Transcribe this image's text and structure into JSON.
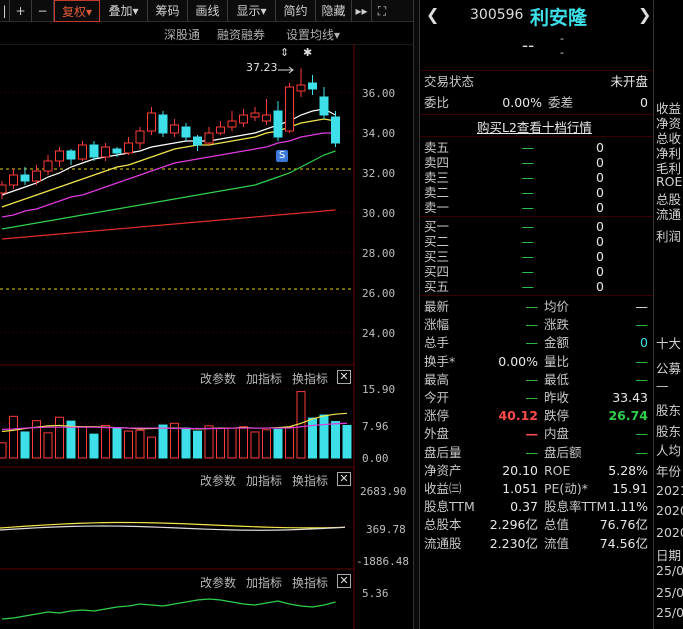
{
  "toolbar": {
    "items": [
      "|",
      "+",
      "−",
      "复权▾",
      "叠加▾",
      "筹码",
      "画线",
      "显示▾",
      "简约",
      "隐藏",
      "▸▸",
      "⛶"
    ],
    "selected": "复权▾"
  },
  "subbar": {
    "items": [
      "深股通",
      "融资融券",
      "设置均线▾"
    ]
  },
  "kline": {
    "peak_label": "37.23",
    "markers": [
      "⇕",
      "✱"
    ],
    "s_badge": "S",
    "y_ticks": [
      "36.00",
      "34.00",
      "32.00",
      "30.00",
      "28.00",
      "26.00",
      "24.00"
    ],
    "dash_levels": [
      32.2,
      26.2
    ],
    "candles": [
      {
        "o": 31.0,
        "c": 31.4,
        "h": 31.6,
        "l": 30.7,
        "up": true
      },
      {
        "o": 31.4,
        "c": 31.9,
        "h": 32.2,
        "l": 31.2,
        "up": true
      },
      {
        "o": 31.9,
        "c": 31.6,
        "h": 32.3,
        "l": 31.4,
        "up": false
      },
      {
        "o": 31.6,
        "c": 32.1,
        "h": 32.4,
        "l": 31.4,
        "up": true
      },
      {
        "o": 32.1,
        "c": 32.6,
        "h": 32.9,
        "l": 31.9,
        "up": true
      },
      {
        "o": 32.6,
        "c": 33.1,
        "h": 33.3,
        "l": 32.3,
        "up": true
      },
      {
        "o": 33.1,
        "c": 32.7,
        "h": 33.2,
        "l": 32.4,
        "up": false
      },
      {
        "o": 32.7,
        "c": 33.4,
        "h": 33.6,
        "l": 32.6,
        "up": true
      },
      {
        "o": 33.4,
        "c": 32.8,
        "h": 33.6,
        "l": 32.6,
        "up": false
      },
      {
        "o": 32.8,
        "c": 33.3,
        "h": 33.5,
        "l": 32.6,
        "up": true
      },
      {
        "o": 33.2,
        "c": 33.0,
        "h": 33.3,
        "l": 32.8,
        "up": false
      },
      {
        "o": 33.0,
        "c": 33.5,
        "h": 33.8,
        "l": 32.9,
        "up": true
      },
      {
        "o": 33.5,
        "c": 34.1,
        "h": 34.3,
        "l": 33.2,
        "up": true
      },
      {
        "o": 34.1,
        "c": 35.0,
        "h": 35.3,
        "l": 33.9,
        "up": true
      },
      {
        "o": 34.9,
        "c": 34.0,
        "h": 35.1,
        "l": 33.8,
        "up": false
      },
      {
        "o": 34.0,
        "c": 34.4,
        "h": 34.7,
        "l": 33.8,
        "up": true
      },
      {
        "o": 34.3,
        "c": 33.8,
        "h": 34.5,
        "l": 33.6,
        "up": false
      },
      {
        "o": 33.8,
        "c": 33.4,
        "h": 33.9,
        "l": 33.1,
        "up": false
      },
      {
        "o": 33.5,
        "c": 34.0,
        "h": 34.3,
        "l": 33.4,
        "up": true
      },
      {
        "o": 34.0,
        "c": 34.3,
        "h": 34.6,
        "l": 33.9,
        "up": true
      },
      {
        "o": 34.3,
        "c": 34.6,
        "h": 35.1,
        "l": 34.1,
        "up": true
      },
      {
        "o": 34.5,
        "c": 34.9,
        "h": 35.2,
        "l": 34.3,
        "up": true
      },
      {
        "o": 34.8,
        "c": 35.0,
        "h": 35.3,
        "l": 34.6,
        "up": true
      },
      {
        "o": 34.6,
        "c": 34.9,
        "h": 35.7,
        "l": 34.4,
        "up": true
      },
      {
        "o": 35.1,
        "c": 33.8,
        "h": 35.6,
        "l": 33.6,
        "up": false
      },
      {
        "o": 34.1,
        "c": 36.3,
        "h": 36.5,
        "l": 34.0,
        "up": true
      },
      {
        "o": 36.1,
        "c": 36.4,
        "h": 37.23,
        "l": 35.8,
        "up": true
      },
      {
        "o": 36.5,
        "c": 36.2,
        "h": 36.9,
        "l": 35.9,
        "up": false
      },
      {
        "o": 35.8,
        "c": 34.9,
        "h": 36.3,
        "l": 34.7,
        "up": false
      },
      {
        "o": 34.8,
        "c": 33.5,
        "h": 35.1,
        "l": 33.3,
        "up": false
      }
    ],
    "ma": {
      "white": [
        30.9,
        31.1,
        31.3,
        31.5,
        31.8,
        32.0,
        32.3,
        32.5,
        32.7,
        32.8,
        32.9,
        33.0,
        33.1,
        33.3,
        33.4,
        33.5,
        33.6,
        33.6,
        33.6,
        33.7,
        33.8,
        33.9,
        34.0,
        34.2,
        34.4,
        34.6,
        34.9,
        35.1,
        35.2,
        34.9
      ],
      "yellow": [
        30.3,
        30.5,
        30.7,
        30.9,
        31.1,
        31.3,
        31.5,
        31.7,
        31.9,
        32.1,
        32.3,
        32.4,
        32.6,
        32.8,
        33.0,
        33.2,
        33.3,
        33.4,
        33.4,
        33.5,
        33.6,
        33.7,
        33.8,
        34.0,
        34.1,
        34.3,
        34.5,
        34.6,
        34.7,
        34.6
      ],
      "magenta": [
        29.8,
        29.9,
        30.1,
        30.2,
        30.4,
        30.6,
        30.8,
        30.9,
        31.1,
        31.3,
        31.5,
        31.7,
        31.9,
        32.1,
        32.3,
        32.5,
        32.6,
        32.7,
        32.8,
        32.9,
        33.0,
        33.1,
        33.2,
        33.3,
        33.5,
        33.6,
        33.8,
        33.9,
        34.0,
        34.0
      ],
      "green": [
        29.2,
        29.3,
        29.4,
        29.5,
        29.6,
        29.7,
        29.8,
        29.9,
        30.0,
        30.1,
        30.2,
        30.3,
        30.4,
        30.5,
        30.6,
        30.7,
        30.8,
        30.9,
        31.0,
        31.1,
        31.2,
        31.3,
        31.4,
        31.6,
        31.8,
        32.0,
        32.3,
        32.6,
        32.9,
        33.1
      ],
      "red": [
        28.7,
        28.75,
        28.8,
        28.85,
        28.9,
        28.95,
        29.0,
        29.05,
        29.1,
        29.15,
        29.2,
        29.25,
        29.3,
        29.35,
        29.4,
        29.45,
        29.5,
        29.55,
        29.6,
        29.65,
        29.7,
        29.75,
        29.8,
        29.85,
        29.9,
        29.95,
        30.0,
        30.05,
        30.1,
        30.15
      ]
    }
  },
  "volume_panel": {
    "tabs": [
      "改参数",
      "加指标",
      "换指标"
    ],
    "y_ticks": [
      "15.90",
      "7.96",
      "0.00"
    ],
    "bars": [
      3.5,
      9.6,
      6.0,
      8.6,
      5.8,
      9.4,
      8.5,
      7.2,
      5.5,
      7.5,
      6.8,
      6.2,
      6.4,
      4.8,
      7.6,
      8.0,
      6.9,
      6.2,
      7.4,
      6.9,
      6.9,
      7.2,
      6.0,
      6.5,
      6.6,
      7.1,
      15.3,
      9.2,
      9.9,
      8.4,
      7.5
    ],
    "bar_up": [
      true,
      true,
      false,
      true,
      true,
      true,
      false,
      true,
      false,
      true,
      false,
      true,
      true,
      true,
      false,
      true,
      false,
      false,
      true,
      true,
      true,
      true,
      true,
      true,
      false,
      true,
      true,
      false,
      false,
      false,
      false
    ],
    "ma_yellow": [
      6.1,
      6.4,
      6.8,
      7.1,
      7.4,
      7.5,
      7.3,
      7.2,
      7.2,
      7.1,
      7.0,
      6.9,
      6.7,
      6.8,
      6.9,
      6.9,
      6.8,
      6.7,
      6.8,
      6.9,
      6.9,
      7.0,
      6.9,
      6.9,
      7.0,
      7.2,
      8.0,
      9.0,
      9.7,
      10.1,
      10.3
    ],
    "ma_magenta": [
      6.6,
      6.7,
      6.9,
      7.0,
      7.1,
      7.1,
      7.1,
      7.1,
      7.1,
      7.0,
      7.0,
      6.9,
      6.9,
      6.9,
      6.9,
      6.8,
      6.8,
      6.8,
      6.8,
      6.8,
      6.9,
      6.9,
      6.9,
      6.9,
      6.9,
      6.9,
      7.2,
      7.5,
      7.7,
      7.9,
      8.0
    ]
  },
  "macd_panel": {
    "tabs": [
      "改参数",
      "加指标",
      "换指标"
    ],
    "y_ticks": [
      "2683.90",
      "369.78",
      "-1886.48"
    ]
  },
  "bottom_panel": {
    "tabs": [
      "改参数",
      "加指标",
      "换指标"
    ],
    "y_ticks": [
      "5.36"
    ]
  },
  "quote": {
    "code": "300596",
    "name": "利安隆",
    "price": "--",
    "change": "-",
    "change_pct": "-",
    "status_label": "交易状态",
    "status": "未开盘",
    "weibi_label": "委比",
    "weibi": "0.00%",
    "weicha_label": "委差",
    "weicha": "0",
    "l2_link": "购买L2查看十档行情",
    "asks": [
      {
        "label": "卖五",
        "price": "—",
        "vol": "0"
      },
      {
        "label": "卖四",
        "price": "—",
        "vol": "0"
      },
      {
        "label": "卖三",
        "price": "—",
        "vol": "0"
      },
      {
        "label": "卖二",
        "price": "—",
        "vol": "0"
      },
      {
        "label": "卖一",
        "price": "—",
        "vol": "0"
      }
    ],
    "bids": [
      {
        "label": "买一",
        "price": "—",
        "vol": "0"
      },
      {
        "label": "买二",
        "price": "—",
        "vol": "0"
      },
      {
        "label": "买三",
        "price": "—",
        "vol": "0"
      },
      {
        "label": "买四",
        "price": "—",
        "vol": "0"
      },
      {
        "label": "买五",
        "price": "—",
        "vol": "0"
      }
    ],
    "stats": [
      {
        "l1": "最新",
        "v1": "—",
        "c1": "g",
        "l2": "均价",
        "v2": "—",
        "c2": "w"
      },
      {
        "l1": "涨幅",
        "v1": "—",
        "c1": "g",
        "l2": "涨跌",
        "v2": "—",
        "c2": "g"
      },
      {
        "l1": "总手",
        "v1": "—",
        "c1": "g",
        "l2": "金额",
        "v2": "0",
        "c2": "c"
      },
      {
        "l1": "换手*",
        "v1": "0.00%",
        "c1": "w",
        "l2": "量比",
        "v2": "—",
        "c2": "g"
      },
      {
        "l1": "最高",
        "v1": "—",
        "c1": "g",
        "l2": "最低",
        "v2": "—",
        "c2": "g"
      },
      {
        "l1": "今开",
        "v1": "—",
        "c1": "g",
        "l2": "昨收",
        "v2": "33.43",
        "c2": "w"
      },
      {
        "l1": "涨停",
        "v1": "40.12",
        "c1": "r",
        "l2": "跌停",
        "v2": "26.74",
        "c2": "g"
      },
      {
        "l1": "外盘",
        "v1": "—",
        "c1": "r",
        "l2": "内盘",
        "v2": "—",
        "c2": "g"
      },
      {
        "l1": "盘后量",
        "v1": "—",
        "c1": "g",
        "l2": "盘后额",
        "v2": "—",
        "c2": "g"
      },
      {
        "l1": "净资产",
        "v1": "20.10",
        "c1": "w",
        "l2": "ROE",
        "v2": "5.28%",
        "c2": "w"
      },
      {
        "l1": "收益㈢",
        "v1": "1.051",
        "c1": "w",
        "l2": "PE(动)*",
        "v2": "15.91",
        "c2": "w"
      },
      {
        "l1": "股息TTM",
        "v1": "0.37",
        "c1": "w",
        "l2": "股息率TTM",
        "v2": "1.11%",
        "c2": "w"
      },
      {
        "l1": "总股本",
        "v1": "2.296亿",
        "c1": "w",
        "l2": "总值",
        "v2": "76.76亿",
        "c2": "w"
      },
      {
        "l1": "流通股",
        "v1": "2.230亿",
        "c1": "w",
        "l2": "流值",
        "v2": "74.56亿",
        "c2": "w"
      }
    ]
  },
  "side": {
    "items": [
      "收益",
      "净资",
      "总收",
      "净利",
      "毛利",
      "ROE",
      "总股",
      "流通",
      "利润",
      "十大",
      "公募",
      "—",
      "股东",
      "股东",
      "人均",
      "年份",
      "2021",
      "2020",
      "2020",
      "日期",
      "25/0",
      "25/0",
      "25/0"
    ]
  }
}
